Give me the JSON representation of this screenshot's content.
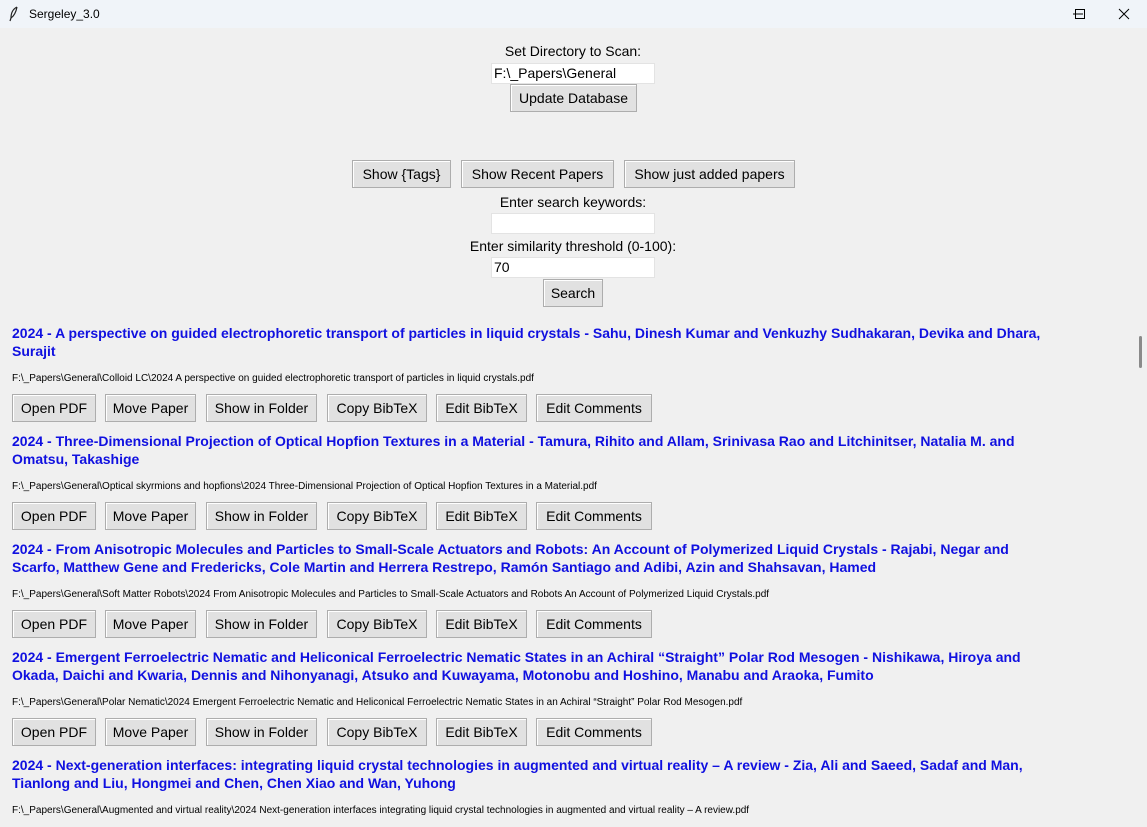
{
  "window": {
    "title": "Sergeley_3.0"
  },
  "directory": {
    "label": "Set Directory to Scan:",
    "value": "F:\\_Papers\\General",
    "update_button": "Update Database"
  },
  "toolbar": {
    "show_tags": "Show {Tags}",
    "show_recent": "Show Recent Papers",
    "show_added": "Show just added papers"
  },
  "search": {
    "keywords_label": "Enter search keywords:",
    "keywords_value": "",
    "threshold_label": "Enter similarity threshold (0-100):",
    "threshold_value": "70",
    "search_button": "Search"
  },
  "paper_actions": [
    "Open PDF",
    "Move Paper",
    "Show in Folder",
    "Copy BibTeX",
    "Edit BibTeX",
    "Edit Comments"
  ],
  "papers": [
    {
      "title": "2024 - A perspective on guided electrophoretic transport of particles in liquid crystals - Sahu, Dinesh Kumar and Venkuzhy Sudhakaran, Devika and Dhara, Surajit",
      "path": "F:\\_Papers\\General\\Colloid LC\\2024 A perspective on guided electrophoretic transport of particles in liquid crystals.pdf"
    },
    {
      "title": "2024 - Three-Dimensional Projection of Optical Hopfion Textures in a Material - Tamura, Rihito and Allam, Srinivasa Rao and Litchinitser, Natalia M. and Omatsu, Takashige",
      "path": "F:\\_Papers\\General\\Optical skyrmions and hopfions\\2024 Three-Dimensional Projection of Optical Hopfion Textures in a Material.pdf"
    },
    {
      "title": "2024 - From Anisotropic Molecules and Particles to Small-Scale Actuators and Robots: An Account of Polymerized Liquid Crystals - Rajabi, Negar and Scarfo, Matthew Gene and Fredericks, Cole Martin and Herrera Restrepo, Ramón Santiago and Adibi, Azin and Shahsavan, Hamed",
      "path": "F:\\_Papers\\General\\Soft Matter Robots\\2024 From Anisotropic Molecules and Particles to Small-Scale Actuators and Robots An Account of Polymerized Liquid Crystals.pdf"
    },
    {
      "title": "2024 - Emergent Ferroelectric Nematic and Heliconical Ferroelectric Nematic States in an Achiral “Straight” Polar Rod Mesogen - Nishikawa, Hiroya and Okada, Daichi and Kwaria, Dennis and Nihonyanagi, Atsuko and Kuwayama, Motonobu and Hoshino, Manabu and Araoka, Fumito",
      "path": "F:\\_Papers\\General\\Polar Nematic\\2024 Emergent Ferroelectric Nematic and Heliconical Ferroelectric Nematic States in an Achiral “Straight” Polar Rod Mesogen.pdf"
    },
    {
      "title": "2024 - Next-generation interfaces: integrating liquid crystal technologies in augmented and virtual reality – A review - Zia, Ali and Saeed, Sadaf and Man, Tianlong and Liu, Hongmei and Chen, Chen Xiao and Wan, Yuhong",
      "path": "F:\\_Papers\\General\\Augmented and virtual reality\\2024 Next-generation interfaces integrating liquid crystal technologies in augmented and virtual reality – A review.pdf"
    }
  ],
  "colors": {
    "title_link": "#1010e0",
    "background": "#f0f0f0",
    "button": "#e1e1e1"
  }
}
